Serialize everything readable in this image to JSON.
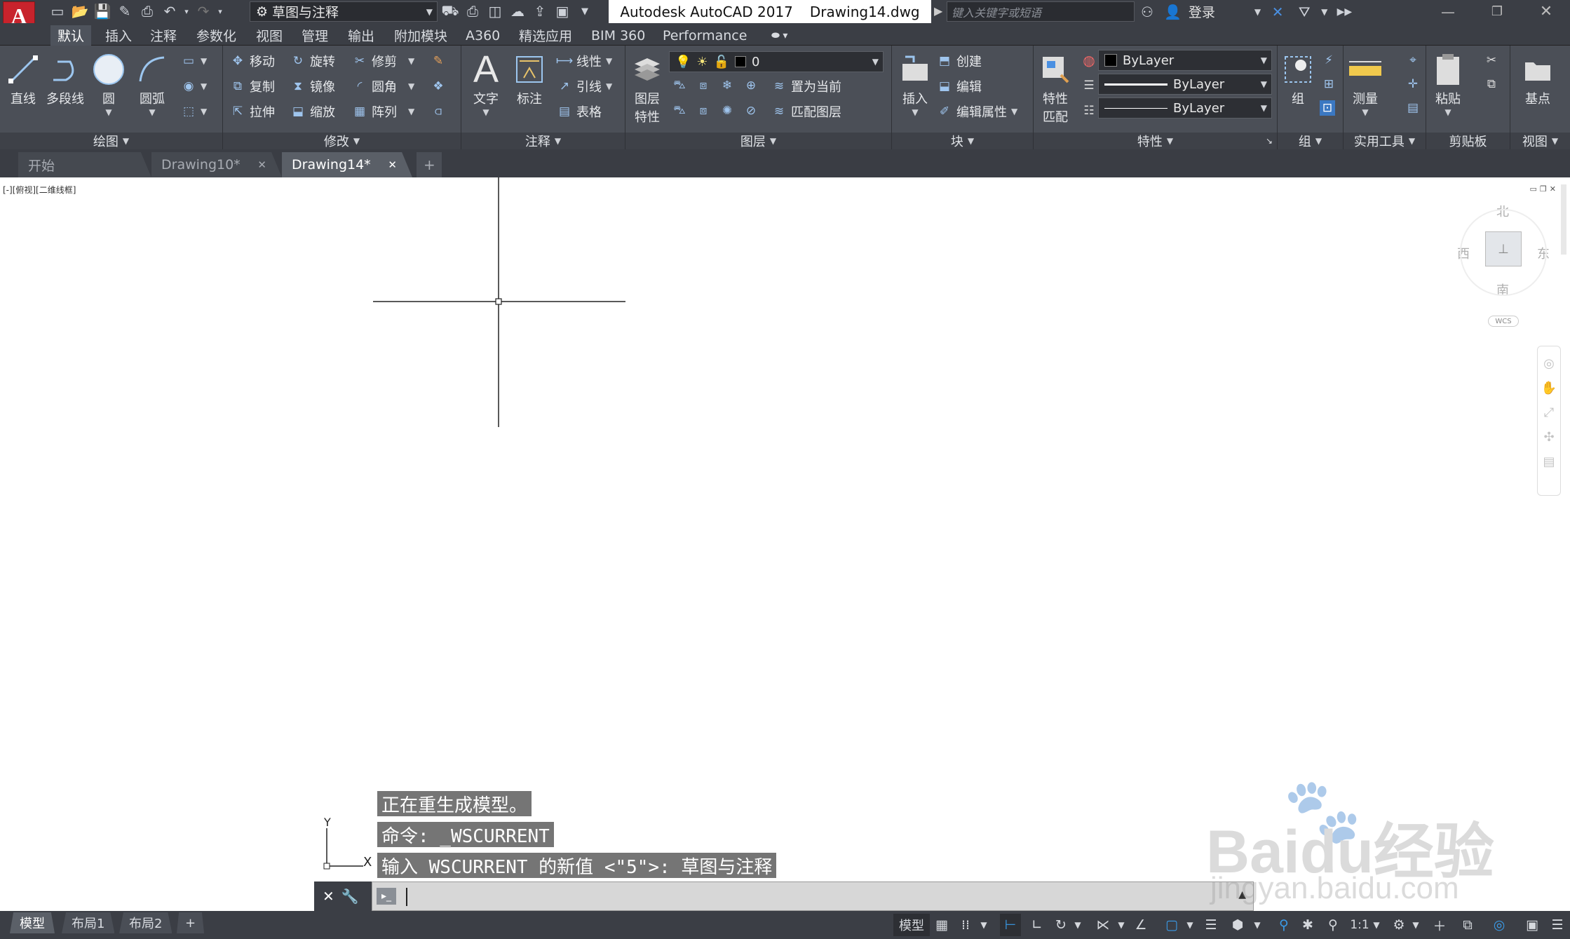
{
  "title_bar": {
    "app_logo_letter": "A",
    "workspace": "草图与注释",
    "app_name": "Autodesk AutoCAD 2017",
    "doc_name": "Drawing14.dwg",
    "search_placeholder": "键入关键字或短语",
    "login_label": "登录"
  },
  "menu_tabs": [
    "默认",
    "插入",
    "注释",
    "参数化",
    "视图",
    "管理",
    "输出",
    "附加模块",
    "A360",
    "精选应用",
    "BIM 360",
    "Performance"
  ],
  "ribbon": {
    "draw": {
      "title": "绘图",
      "line": "直线",
      "polyline": "多段线",
      "circle": "圆",
      "arc": "圆弧"
    },
    "modify": {
      "title": "修改",
      "move": "移动",
      "rotate": "旋转",
      "trim": "修剪",
      "copy": "复制",
      "mirror": "镜像",
      "fillet": "圆角",
      "stretch": "拉伸",
      "scale": "缩放",
      "array": "阵列"
    },
    "annotation": {
      "title": "注释",
      "text": "文字",
      "dimension": "标注",
      "linear": "线性",
      "leader": "引线",
      "table": "表格"
    },
    "layers": {
      "title": "图层",
      "layer_props_l1": "图层",
      "layer_props_l2": "特性",
      "current_layer": "0",
      "set_current": "置为当前",
      "match_layer": "匹配图层"
    },
    "block": {
      "title": "块",
      "insert": "插入",
      "create": "创建",
      "edit": "编辑",
      "edit_attr": "编辑属性"
    },
    "properties": {
      "title": "特性",
      "match_l1": "特性",
      "match_l2": "匹配",
      "color": "ByLayer",
      "linetype": "ByLayer",
      "lineweight": "ByLayer"
    },
    "groups": {
      "title": "组",
      "group": "组"
    },
    "utilities": {
      "title": "实用工具",
      "measure": "测量"
    },
    "clipboard": {
      "title": "剪贴板",
      "paste": "粘贴"
    },
    "view": {
      "title": "视图",
      "base": "基点"
    }
  },
  "file_tabs": [
    "开始",
    "Drawing10*",
    "Drawing14*"
  ],
  "viewport": {
    "label": "[-][俯视][二维线框]",
    "compass": {
      "n": "北",
      "s": "南",
      "e": "东",
      "w": "西",
      "wcs": "WCS"
    },
    "ucs_x": "X",
    "ucs_y": "Y"
  },
  "command_history": [
    "正在重生成模型。",
    "命令: _WSCURRENT",
    "输入 WSCURRENT 的新值 <\"5\">: 草图与注释"
  ],
  "layout_tabs": [
    "模型",
    "布局1",
    "布局2"
  ],
  "status": {
    "model": "模型",
    "scale": "1:1"
  },
  "watermark": {
    "brand": "Baidu经验",
    "url": "jingyan.baidu.com"
  }
}
